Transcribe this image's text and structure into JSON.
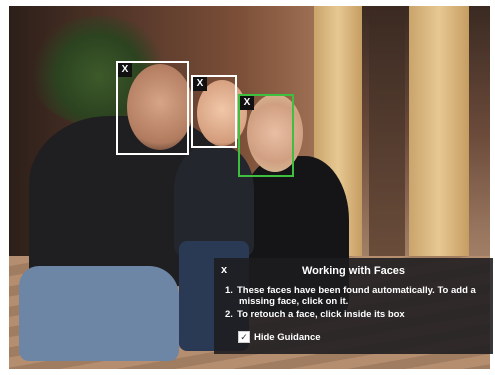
{
  "photo": {
    "faces": [
      {
        "name": "face-1",
        "close_label": "X",
        "color": "#ffffff"
      },
      {
        "name": "face-2",
        "close_label": "X",
        "color": "#ffffff"
      },
      {
        "name": "face-3",
        "close_label": "X",
        "color": "#3fbf3f"
      }
    ]
  },
  "guidance": {
    "close_label": "x",
    "title": "Working with Faces",
    "steps": [
      {
        "num": "1.",
        "text": "These faces have been found automatically. To add a missing face, click on it."
      },
      {
        "num": "2.",
        "text": "To retouch a face, click inside its box"
      }
    ],
    "hide_label": "Hide Guidance",
    "hide_checked": true,
    "check_glyph": "✓"
  },
  "colors": {
    "panel_bg": "#1c1c20",
    "face_selected": "#3fbf3f",
    "face_default": "#ffffff"
  }
}
